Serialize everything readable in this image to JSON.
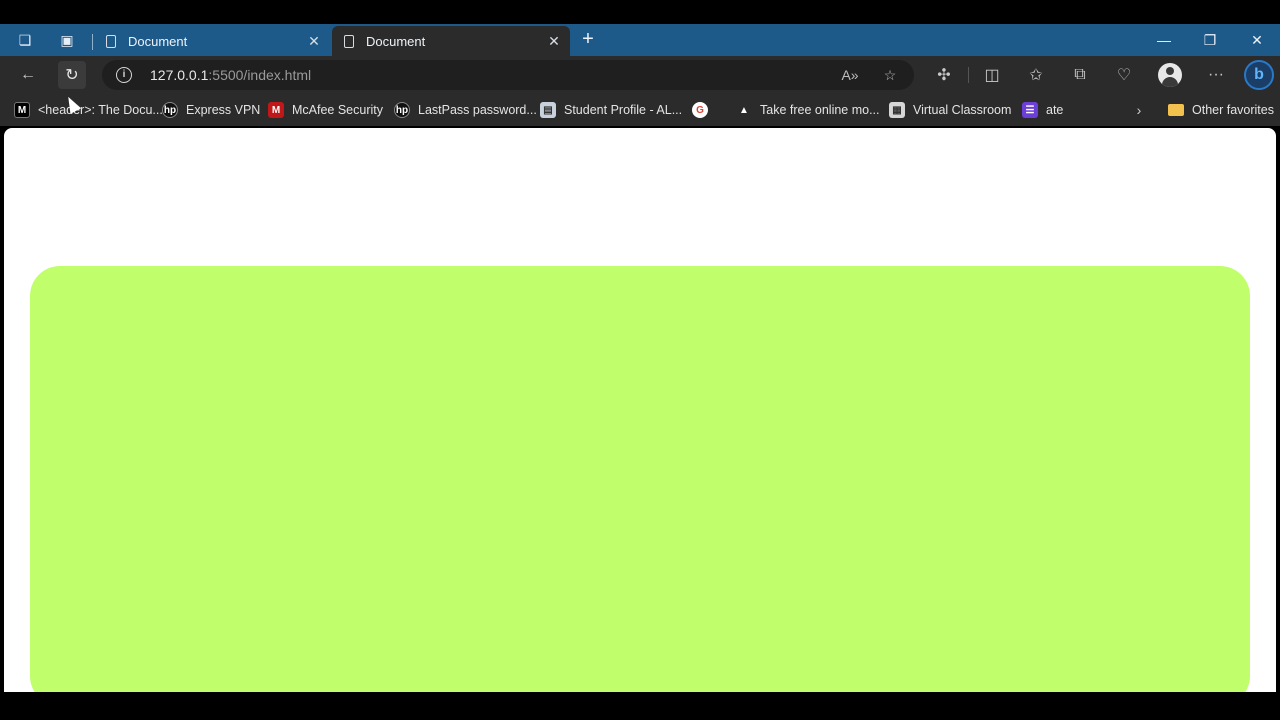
{
  "browser": {
    "tabs": [
      {
        "label": "Document",
        "active": false
      },
      {
        "label": "Document",
        "active": true
      }
    ],
    "address": {
      "host": "127.0.0.1",
      "path": ":5500/index.html"
    },
    "favorites": [
      {
        "label": "<header>: The Docu...",
        "icon": "mdn-icon",
        "color": "#000000"
      },
      {
        "label": "Express VPN",
        "icon": "hp-icon",
        "color": "#111111"
      },
      {
        "label": "McAfee Security",
        "icon": "mcafee-icon",
        "color": "#c01818"
      },
      {
        "label": "LastPass password...",
        "icon": "hp-icon",
        "color": "#111111"
      },
      {
        "label": "Student Profile - AL...",
        "icon": "profile-icon",
        "color": "#c7d2dc"
      },
      {
        "label": "",
        "icon": "google-icon",
        "color": "#ffffff"
      },
      {
        "label": "Take free online mo...",
        "icon": "course-icon",
        "color": "#ffffff"
      },
      {
        "label": "Virtual Classroom",
        "icon": "classroom-icon",
        "color": "#d6d6d6"
      },
      {
        "label": "ate",
        "icon": "list-icon",
        "color": "#6c3fd8"
      }
    ],
    "other_favorites": "Other favorites"
  },
  "page": {
    "box_color": "#c0ff6b"
  }
}
